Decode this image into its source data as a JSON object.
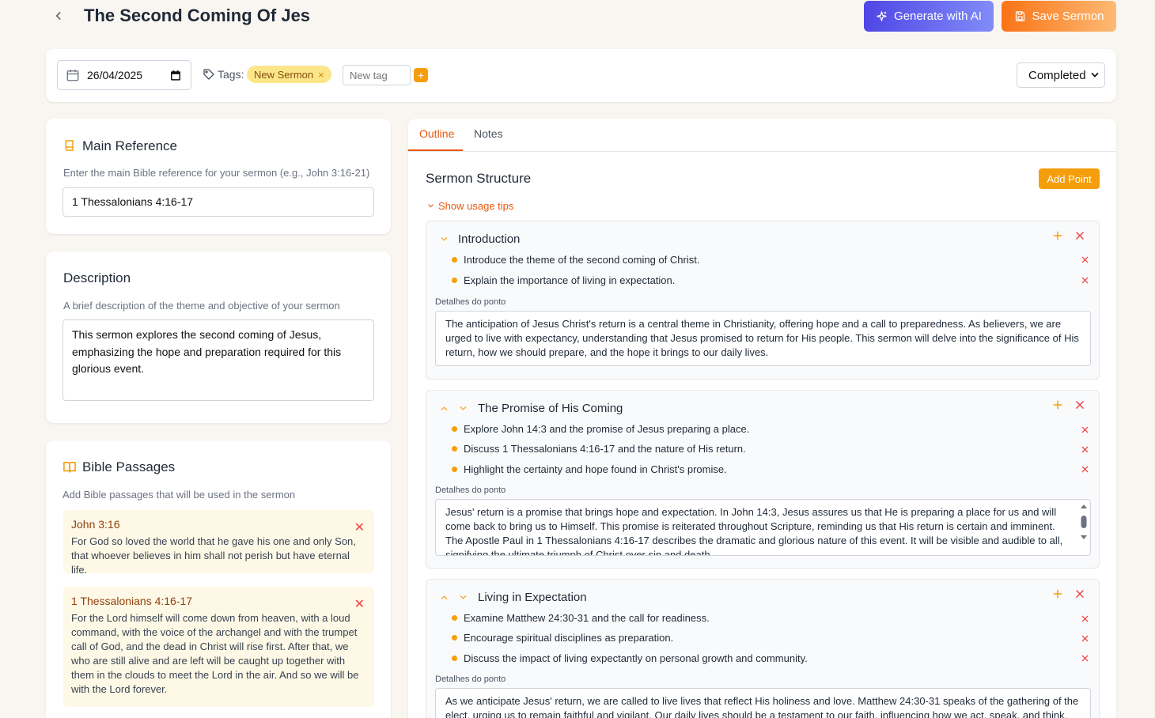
{
  "header": {
    "title": "The Second Coming Of Jesus",
    "generate_label": "Generate with AI",
    "save_label": "Save Sermon"
  },
  "meta": {
    "date": "26/04/2025",
    "tags_label": "Tags:",
    "tags": [
      "New Sermon"
    ],
    "new_tag_placeholder": "New tag",
    "status": "Completed"
  },
  "main_reference": {
    "title": "Main Reference",
    "hint": "Enter the main Bible reference for your sermon (e.g., John 3:16-21)",
    "value": "1 Thessalonians 4:16-17"
  },
  "description": {
    "title": "Description",
    "hint": "A brief description of the theme and objective of your sermon",
    "value": "This sermon explores the second coming of Jesus, emphasizing the hope and preparation required for this glorious event."
  },
  "bible_passages": {
    "title": "Bible Passages",
    "hint": "Add Bible passages that will be used in the sermon",
    "items": [
      {
        "ref": "John 3:16",
        "text": "For God so loved the world that he gave his one and only Son, that whoever believes in him shall not perish but have eternal life."
      },
      {
        "ref": "1 Thessalonians 4:16-17",
        "text": "For the Lord himself will come down from heaven, with a loud command, with the voice of the archangel and with the trumpet call of God, and the dead in Christ will rise first. After that, we who are still alive and are left will be caught up together with them in the clouds to meet the Lord in the air. And so we will be with the Lord forever."
      }
    ]
  },
  "tabs": [
    "Outline",
    "Notes"
  ],
  "structure": {
    "title": "Sermon Structure",
    "add_point_label": "Add Point",
    "tips_label": "Show usage tips",
    "details_label": "Detalhes do ponto",
    "points": [
      {
        "title": "Introduction",
        "subpoints": [
          "Introduce the theme of the second coming of Christ.",
          "Explain the importance of living in expectation."
        ],
        "details": "The anticipation of Jesus Christ's return is a central theme in Christianity, offering hope and a call to preparedness. As believers, we are urged to live with expectancy, understanding that Jesus promised to return for His people. This sermon will delve into the significance of His return, how we should prepare, and the hope it brings to our daily lives."
      },
      {
        "title": "The Promise of His Coming",
        "subpoints": [
          "Explore John 14:3 and the promise of Jesus preparing a place.",
          "Discuss 1 Thessalonians 4:16-17 and the nature of His return.",
          "Highlight the certainty and hope found in Christ's promise."
        ],
        "details": "Jesus' return is a promise that brings hope and expectation. In John 14:3, Jesus assures us that He is preparing a place for us and will come back to bring us to Himself. This promise is reiterated throughout Scripture, reminding us that His return is certain and imminent. The Apostle Paul in 1 Thessalonians 4:16-17 describes the dramatic and glorious nature of this event. It will be visible and audible to all, signifying the ultimate triumph of Christ over sin and death."
      },
      {
        "title": "Living in Expectation",
        "subpoints": [
          "Examine Matthew 24:30-31 and the call for readiness.",
          "Encourage spiritual disciplines as preparation.",
          "Discuss the impact of living expectantly on personal growth and community."
        ],
        "details": "As we anticipate Jesus' return, we are called to live lives that reflect His holiness and love. Matthew 24:30-31 speaks of the gathering of the elect, urging us to remain faithful and vigilant. Our daily lives should be a testament to our faith, influencing how we act, speak, and think. This"
      }
    ]
  },
  "colors": {
    "accent": "#f59e0b",
    "orange": "#ea580c",
    "indigo": "#4f46e5",
    "danger": "#ef4444",
    "background": "#f9f6f1"
  }
}
